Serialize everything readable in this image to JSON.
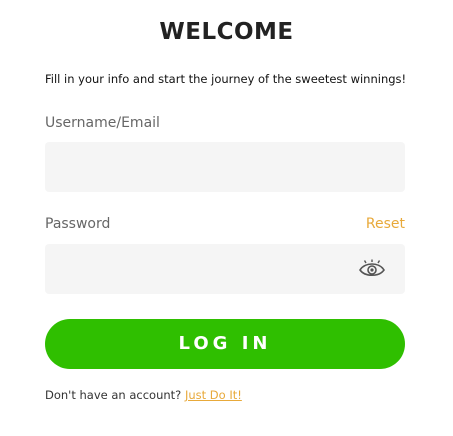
{
  "header": {
    "title": "WELCOME",
    "subtitle": "Fill in your info and start the journey of the sweetest winnings!"
  },
  "form": {
    "username_label": "Username/Email",
    "username_value": "",
    "password_label": "Password",
    "password_value": "",
    "reset_label": "Reset",
    "toggle_icon": "eye-icon",
    "login_label": "LOG IN"
  },
  "footer": {
    "prompt": "Don't have an account?",
    "signup_label": "Just Do It!"
  },
  "colors": {
    "accent": "#e8a93a",
    "login_button": "#2fbf00",
    "field_background": "#f5f5f5"
  }
}
